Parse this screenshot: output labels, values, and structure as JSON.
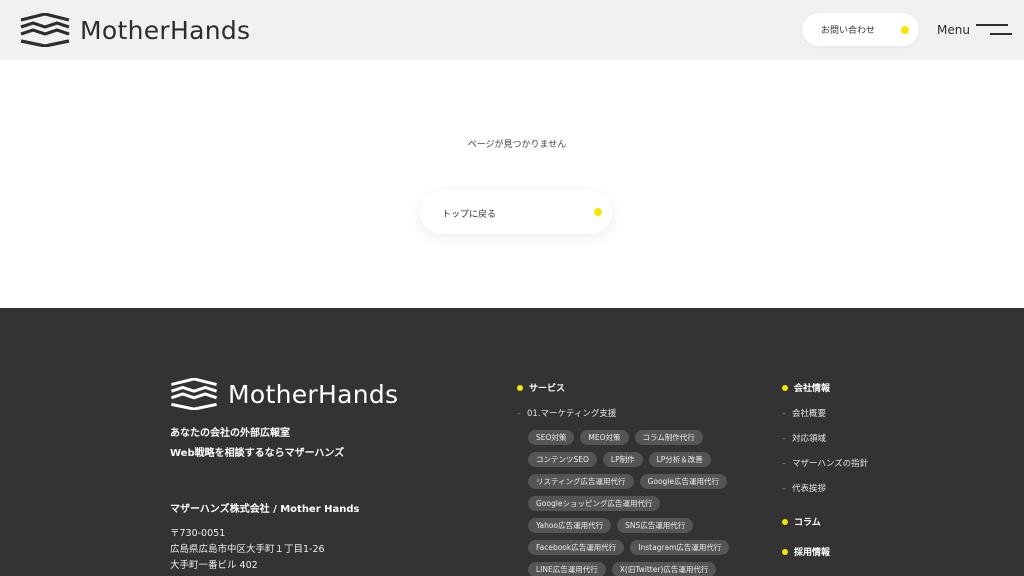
{
  "header": {
    "logo_text": "MotherHands",
    "contact_label": "お問い合わせ",
    "menu_label": "Menu"
  },
  "main": {
    "not_found_text": "ページが見つかりません",
    "back_label": "トップに戻る"
  },
  "footer": {
    "logo_text": "MotherHands",
    "tagline_1": "あなたの会社の外部広報室",
    "tagline_2": "Web戦略を相談するならマザーハンズ",
    "company_name": "マザーハンズ株式会社 / Mother Hands",
    "postal": "〒730-0051",
    "address_1": "広島県広島市中区大手町１丁目1-26",
    "address_2": "大手町一番ビル 402",
    "services_heading": "サービス",
    "marketing_link": "01.マーケティング支援",
    "tag_rows": [
      [
        "SEO対策",
        "MEO対策",
        "コラム制作代行"
      ],
      [
        "コンテンツSEO",
        "LP制作",
        "LP分析＆改善"
      ],
      [
        "リスティング広告運用代行",
        "Google広告運用代行"
      ],
      [
        "Googleショッピング広告運用代行"
      ],
      [
        "Yahoo広告運用代行",
        "SNS広告運用代行"
      ],
      [
        "Facebook広告運用代行",
        "Instagram広告運用代行"
      ],
      [
        "LINE広告運用代行",
        "X(旧Twitter)広告運用代行"
      ]
    ],
    "company_heading": "会社情報",
    "company_links": [
      "会社概要",
      "対応領域",
      "マザーハンズの指針",
      "代表挨拶"
    ],
    "column_heading": "コラム",
    "recruit_heading": "採用情報"
  },
  "colors": {
    "accent": "#f5e600",
    "footer_bg": "#333333",
    "header_bg": "#f0f1f2",
    "tag_bg": "#555555"
  },
  "icons": [
    "logo-mark",
    "menu-icon",
    "arrow-icon"
  ]
}
